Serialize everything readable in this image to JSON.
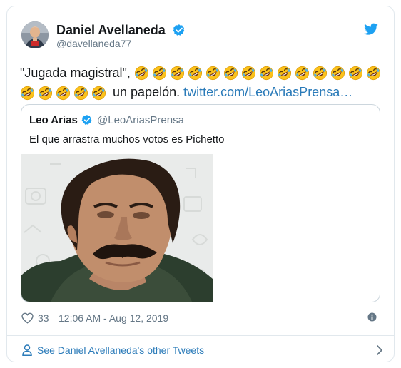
{
  "tweet": {
    "author_name": "Daniel Avellaneda",
    "author_handle": "@davellaneda77",
    "text_start": "\"Jugada magistral\",",
    "emoji_name": "rolling-on-the-floor-laughing",
    "emoji_count_line1": 14,
    "emoji_count_line2": 5,
    "text_end": "un papelón.",
    "link_text": "twitter.com/LeoAriasPrensa…",
    "like_count": "33",
    "timestamp": "12:06 AM - Aug 12, 2019",
    "see_more": "See Daniel Avellaneda's other Tweets"
  },
  "quoted_tweet": {
    "author_name": "Leo Arias",
    "author_handle": "@LeoAriasPrensa",
    "text": "El que arrastra muchos votos es Pichetto",
    "media": "photo-man-with-mustache"
  },
  "icons": {
    "verified": "verified-badge-icon",
    "twitter": "twitter-bird-icon",
    "like": "heart-icon",
    "info": "info-icon",
    "person": "person-icon",
    "chevron": "chevron-right-icon"
  },
  "colors": {
    "brand": "#1da1f2",
    "link": "#2b7bb9",
    "text": "#14171a",
    "secondary": "#657786",
    "border": "#e1e8ed"
  }
}
